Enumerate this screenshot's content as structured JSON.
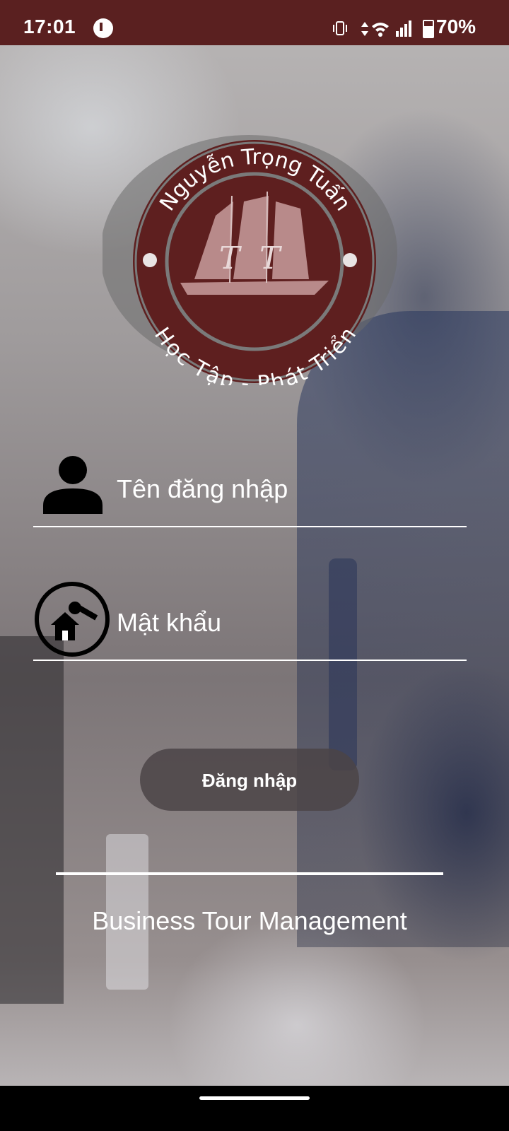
{
  "status_bar": {
    "time": "17:01",
    "battery_percent": "70%"
  },
  "logo": {
    "top_text": "Nguyễn Trọng Tuấn",
    "bottom_text": "Học Tập - Phát Triển",
    "monogram_left": "T",
    "monogram_right": "T",
    "colors": {
      "ring": "#5e1f1f",
      "outer": "#6a6a6a",
      "sail": "#b88a8a"
    }
  },
  "login_form": {
    "username_placeholder": "Tên đăng nhập",
    "password_placeholder": "Mật khẩu",
    "login_label": "Đăng nhập"
  },
  "footer": {
    "app_name": "Business Tour Management"
  },
  "colors": {
    "status_bar": "#5a2020",
    "button_bg": "#4b4446",
    "text": "#ffffff"
  }
}
